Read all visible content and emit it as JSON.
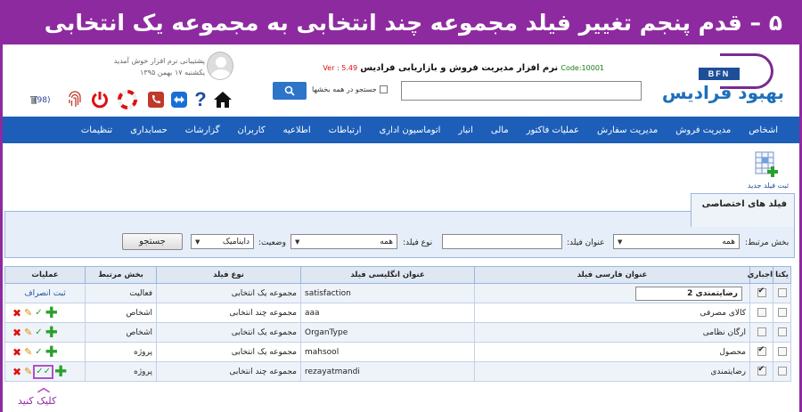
{
  "banner": {
    "title": "۵ – قدم پنجم تغییر فیلد مجموعه چند انتخابی به مجموعه یک انتخابی"
  },
  "header": {
    "logo_short": "BFN",
    "logo_text": "بهبود فرادیس",
    "code": "Code:10001",
    "app_name": "نرم افزار مدیریت فروش و بازاریابی فرادیس",
    "version": "Ver : 5.49",
    "welcome": "پشتیبانی نرم افزار خوش آمدید",
    "date": "یکشنبه ۱۷ بهمن ۱۳۹۵",
    "search_all_label": "جستجو در همه بخشها",
    "search_value": "",
    "trash_count": "(98)"
  },
  "nav": [
    "اشخاص",
    "مدیریت فروش",
    "مدیریت سفارش",
    "عملیات فاکتور",
    "مالی",
    "انبار",
    "اتوماسیون اداری",
    "ارتباطات",
    "اطلاعیه",
    "کاربران",
    "گزارشات",
    "حسابداری",
    "تنظیمات"
  ],
  "page": {
    "add_field_label": "ثبت فیلد جدید",
    "section_title": "فیلد های اختصاصی"
  },
  "filter": {
    "section_label": "بخش مرتبط:",
    "section_value": "همه",
    "title_label": "عنوان فیلد:",
    "title_value": "",
    "type_label": "نوع فیلد:",
    "type_value": "همه",
    "status_label": "وضعیت:",
    "status_value": "داینامیک",
    "search_button": "جستجو"
  },
  "table": {
    "headers": [
      "یکتا",
      "اجباری",
      "عنوان فارسی فیلد",
      "عنوان انگلیسی فیلد",
      "نوع فیلد",
      "بخش مرتبط",
      "عملیات"
    ],
    "rows": [
      {
        "unique": false,
        "required": true,
        "fa_title": "رضایتمندی 2",
        "en_title": "satisfaction",
        "type": "مجموعه یک انتخابی",
        "section": "فعالیت",
        "op_link": "ثبت انصراف"
      },
      {
        "unique": false,
        "required": false,
        "fa_title": "کالای مصرفی",
        "en_title": "aaa",
        "type": "مجموعه چند انتخابی",
        "section": "اشخاص"
      },
      {
        "unique": false,
        "required": false,
        "fa_title": "ارگان نظامی",
        "en_title": "OrganType",
        "type": "مجموعه یک انتخابی",
        "section": "اشخاص"
      },
      {
        "unique": false,
        "required": true,
        "fa_title": "محصول",
        "en_title": "mahsool",
        "type": "مجموعه یک انتخابی",
        "section": "پروژه"
      },
      {
        "unique": false,
        "required": true,
        "fa_title": "رضایتمندی",
        "en_title": "rezayatmandi",
        "type": "مجموعه چند انتخابی",
        "section": "پروژه"
      }
    ]
  },
  "callout": {
    "label": "کلیک کنید"
  },
  "colors": {
    "banner": "#8e2aa0",
    "nav": "#1c5eb8",
    "highlight": "#b04fc3"
  }
}
